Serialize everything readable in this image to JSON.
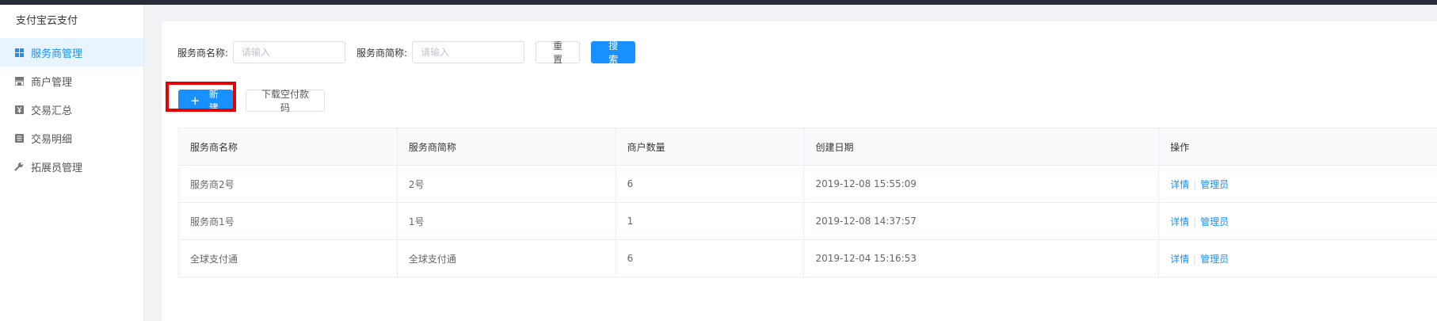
{
  "sidebar": {
    "brand": "支付宝云支付",
    "items": [
      {
        "label": "服务商管理",
        "icon": "grid-icon",
        "active": true
      },
      {
        "label": "商户管理",
        "icon": "store-icon",
        "active": false
      },
      {
        "label": "交易汇总",
        "icon": "yen-icon",
        "active": false
      },
      {
        "label": "交易明细",
        "icon": "list-icon",
        "active": false
      },
      {
        "label": "拓展员管理",
        "icon": "wrench-icon",
        "active": false
      }
    ]
  },
  "search": {
    "name_label": "服务商名称:",
    "name_placeholder": "请输入",
    "short_label": "服务商简称:",
    "short_placeholder": "请输入",
    "reset_label": "重 置",
    "search_label": "搜 索"
  },
  "actions": {
    "new_label": "新建",
    "download_label": "下载空付款码"
  },
  "table": {
    "headers": [
      "服务商名称",
      "服务商简称",
      "商户数量",
      "创建日期",
      "操作"
    ],
    "rows": [
      {
        "name": "服务商2号",
        "short": "2号",
        "count": "6",
        "date": "2019-12-08 15:55:09"
      },
      {
        "name": "服务商1号",
        "short": "1号",
        "count": "1",
        "date": "2019-12-08 14:37:57"
      },
      {
        "name": "全球支付通",
        "short": "全球支付通",
        "count": "6",
        "date": "2019-12-04 15:16:53"
      }
    ],
    "op_detail": "详情",
    "op_sep": "|",
    "op_admin": "管理员"
  },
  "colors": {
    "accent": "#1890ff",
    "highlight": "#e60000"
  }
}
